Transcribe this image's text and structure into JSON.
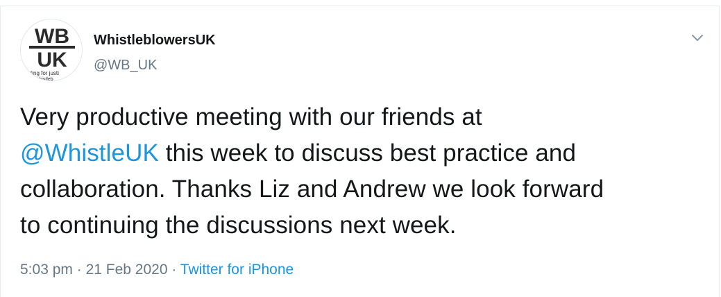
{
  "author": {
    "display_name": "WhistleblowersUK",
    "handle": "@WB_UK",
    "avatar": {
      "logo_top": "WB",
      "logo_bottom": "UK",
      "tagline_1": "ghting for justi",
      "tagline_2": "whistleb"
    }
  },
  "menu": {
    "icon": "chevron-down-icon"
  },
  "tweet": {
    "line1": "Very productive meeting with our friends at",
    "mention": "@WhistleUK",
    "line2_rest": " this week to discuss best practice and",
    "line3": "collaboration. Thanks Liz and Andrew we look forward",
    "line4": "to continuing the discussions next week."
  },
  "meta": {
    "time": "5:03 pm",
    "separator1": " · ",
    "date": "21 Feb 2020",
    "separator2": " · ",
    "source": "Twitter for iPhone"
  },
  "colors": {
    "link": "#1b95e0",
    "secondary_text": "#657786",
    "primary_text": "#14171a"
  }
}
